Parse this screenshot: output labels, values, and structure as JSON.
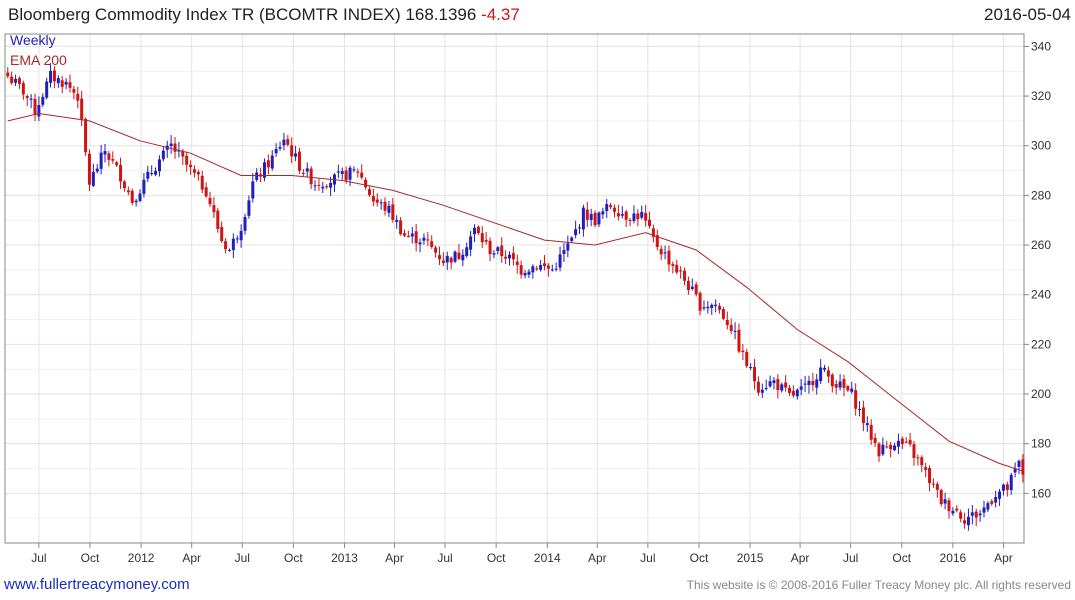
{
  "header": {
    "title": "Bloomberg Commodity Index TR (BCOMTR INDEX)",
    "last": "168.1396",
    "change": "-4.37",
    "date": "2016-05-04"
  },
  "footer": {
    "site": "www.fullertreacymoney.com",
    "copyright": "This website is © 2008-2016 Fuller Treacy Money plc. All rights reserved"
  },
  "colors": {
    "up": "#1f1fbf",
    "down": "#d01414",
    "ema": "#a52a2a",
    "grid": "#e3e3e3"
  },
  "chart_data": {
    "type": "candlestick",
    "legend": [
      "Weekly",
      "EMA 200"
    ],
    "legend_placement": "top-left",
    "y_axis_side": "right",
    "ylim": [
      140,
      345
    ],
    "yticks": [
      160,
      180,
      200,
      220,
      240,
      260,
      280,
      300,
      320,
      340
    ],
    "grid": true,
    "x_start": "2011-05-01",
    "x_end": "2016-05-08",
    "xticks": [
      {
        "label": "Jul",
        "date": "2011-07-01"
      },
      {
        "label": "Oct",
        "date": "2011-10-01"
      },
      {
        "label": "2012",
        "date": "2012-01-01"
      },
      {
        "label": "Apr",
        "date": "2012-04-01"
      },
      {
        "label": "Jul",
        "date": "2012-07-01"
      },
      {
        "label": "Oct",
        "date": "2012-10-01"
      },
      {
        "label": "2013",
        "date": "2013-01-01"
      },
      {
        "label": "Apr",
        "date": "2013-04-01"
      },
      {
        "label": "Jul",
        "date": "2013-07-01"
      },
      {
        "label": "Oct",
        "date": "2013-10-01"
      },
      {
        "label": "2014",
        "date": "2014-01-01"
      },
      {
        "label": "Apr",
        "date": "2014-04-01"
      },
      {
        "label": "Jul",
        "date": "2014-07-01"
      },
      {
        "label": "Oct",
        "date": "2014-10-01"
      },
      {
        "label": "2015",
        "date": "2015-01-01"
      },
      {
        "label": "Apr",
        "date": "2015-04-01"
      },
      {
        "label": "Jul",
        "date": "2015-07-01"
      },
      {
        "label": "Oct",
        "date": "2015-10-01"
      },
      {
        "label": "2016",
        "date": "2016-01-01"
      },
      {
        "label": "Apr",
        "date": "2016-04-01"
      }
    ],
    "close_anchors": [
      [
        "2011-05-06",
        328
      ],
      [
        "2011-06-03",
        322
      ],
      [
        "2011-06-24",
        314
      ],
      [
        "2011-07-22",
        328
      ],
      [
        "2011-08-19",
        325
      ],
      [
        "2011-09-09",
        320
      ],
      [
        "2011-09-30",
        285
      ],
      [
        "2011-10-28",
        298
      ],
      [
        "2011-11-25",
        288
      ],
      [
        "2011-12-16",
        278
      ],
      [
        "2012-01-27",
        292
      ],
      [
        "2012-02-24",
        300
      ],
      [
        "2012-03-23",
        292
      ],
      [
        "2012-04-27",
        282
      ],
      [
        "2012-05-25",
        262
      ],
      [
        "2012-06-08",
        258
      ],
      [
        "2012-06-29",
        268
      ],
      [
        "2012-07-20",
        285
      ],
      [
        "2012-08-24",
        295
      ],
      [
        "2012-09-14",
        303
      ],
      [
        "2012-10-12",
        292
      ],
      [
        "2012-11-09",
        285
      ],
      [
        "2012-12-07",
        286
      ],
      [
        "2013-01-25",
        290
      ],
      [
        "2013-02-22",
        278
      ],
      [
        "2013-03-22",
        274
      ],
      [
        "2013-04-19",
        264
      ],
      [
        "2013-05-24",
        262
      ],
      [
        "2013-06-28",
        254
      ],
      [
        "2013-07-26",
        256
      ],
      [
        "2013-08-23",
        266
      ],
      [
        "2013-09-20",
        258
      ],
      [
        "2013-10-18",
        256
      ],
      [
        "2013-11-15",
        250
      ],
      [
        "2013-12-13",
        252
      ],
      [
        "2014-01-10",
        250
      ],
      [
        "2014-02-14",
        262
      ],
      [
        "2014-03-07",
        273
      ],
      [
        "2014-03-28",
        270
      ],
      [
        "2014-04-25",
        276
      ],
      [
        "2014-05-23",
        272
      ],
      [
        "2014-06-20",
        272
      ],
      [
        "2014-07-11",
        262
      ],
      [
        "2014-08-08",
        254
      ],
      [
        "2014-09-05",
        246
      ],
      [
        "2014-10-03",
        236
      ],
      [
        "2014-10-31",
        236
      ],
      [
        "2014-11-28",
        227
      ],
      [
        "2014-12-19",
        215
      ],
      [
        "2015-01-16",
        203
      ],
      [
        "2015-02-13",
        205
      ],
      [
        "2015-03-13",
        199
      ],
      [
        "2015-04-10",
        202
      ],
      [
        "2015-05-08",
        210
      ],
      [
        "2015-06-05",
        204
      ],
      [
        "2015-07-03",
        200
      ],
      [
        "2015-07-31",
        186
      ],
      [
        "2015-08-21",
        177
      ],
      [
        "2015-09-18",
        181
      ],
      [
        "2015-10-16",
        178
      ],
      [
        "2015-11-13",
        168
      ],
      [
        "2015-12-11",
        157
      ],
      [
        "2016-01-08",
        153
      ],
      [
        "2016-01-22",
        150
      ],
      [
        "2016-02-19",
        152
      ],
      [
        "2016-03-18",
        160
      ],
      [
        "2016-04-08",
        162
      ],
      [
        "2016-04-29",
        172
      ],
      [
        "2016-05-06",
        168
      ]
    ],
    "ema_200": [
      [
        "2011-05-06",
        310
      ],
      [
        "2011-07-01",
        313
      ],
      [
        "2011-09-30",
        310
      ],
      [
        "2011-12-30",
        302
      ],
      [
        "2012-03-30",
        297
      ],
      [
        "2012-06-29",
        288
      ],
      [
        "2012-09-28",
        288
      ],
      [
        "2012-12-28",
        286
      ],
      [
        "2013-03-29",
        282
      ],
      [
        "2013-06-28",
        276
      ],
      [
        "2013-09-27",
        269
      ],
      [
        "2013-12-27",
        262
      ],
      [
        "2014-03-28",
        260
      ],
      [
        "2014-06-27",
        265
      ],
      [
        "2014-09-26",
        258
      ],
      [
        "2014-12-26",
        243
      ],
      [
        "2015-03-27",
        226
      ],
      [
        "2015-06-26",
        213
      ],
      [
        "2015-09-25",
        197
      ],
      [
        "2015-12-25",
        181
      ],
      [
        "2016-03-25",
        172
      ],
      [
        "2016-05-06",
        169
      ]
    ]
  }
}
